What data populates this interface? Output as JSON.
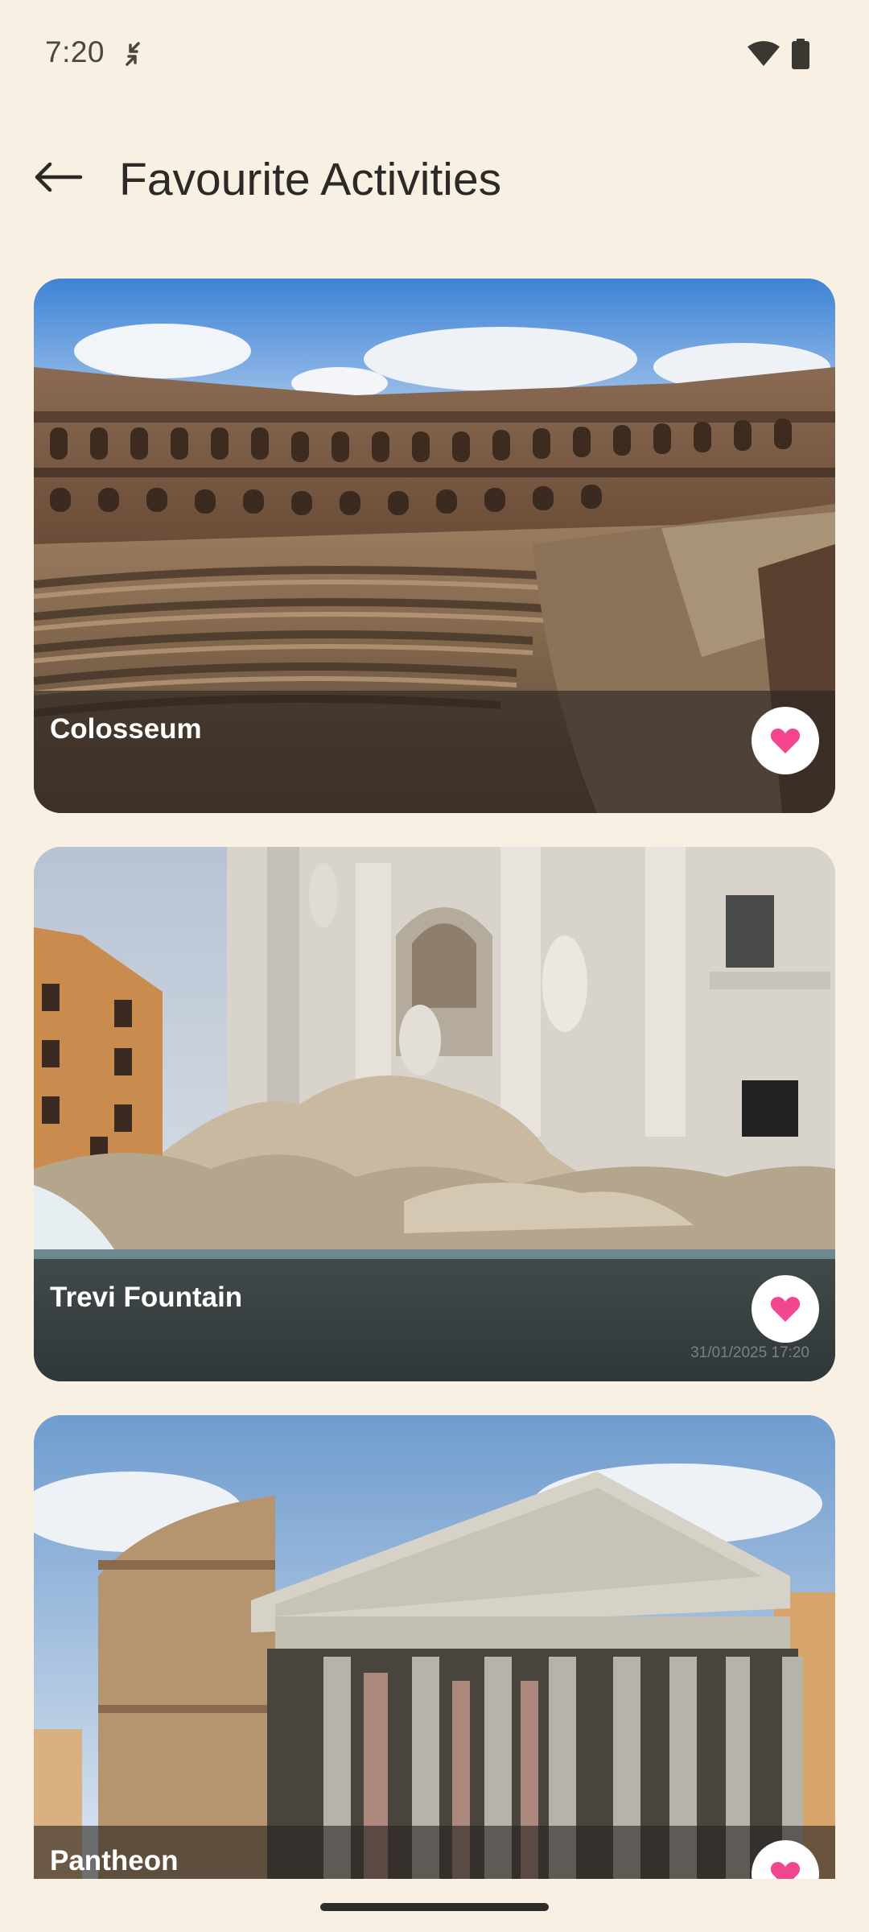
{
  "status": {
    "time": "7:20"
  },
  "header": {
    "title": "Favourite Activities"
  },
  "activities": [
    {
      "name": "Colosseum",
      "favorite": true
    },
    {
      "name": "Trevi Fountain",
      "favorite": true,
      "photo_stamp": "31/01/2025 17:20"
    },
    {
      "name": "Pantheon",
      "favorite": true
    }
  ],
  "colors": {
    "background": "#f8f0e3",
    "favorite_heart": "#f2468f",
    "overlay": "rgba(40,36,32,0.62)"
  },
  "icons": {
    "back": "arrow-left-icon",
    "favorite": "heart-icon",
    "wifi": "wifi-icon",
    "battery": "battery-icon",
    "sync": "sync-icon"
  }
}
